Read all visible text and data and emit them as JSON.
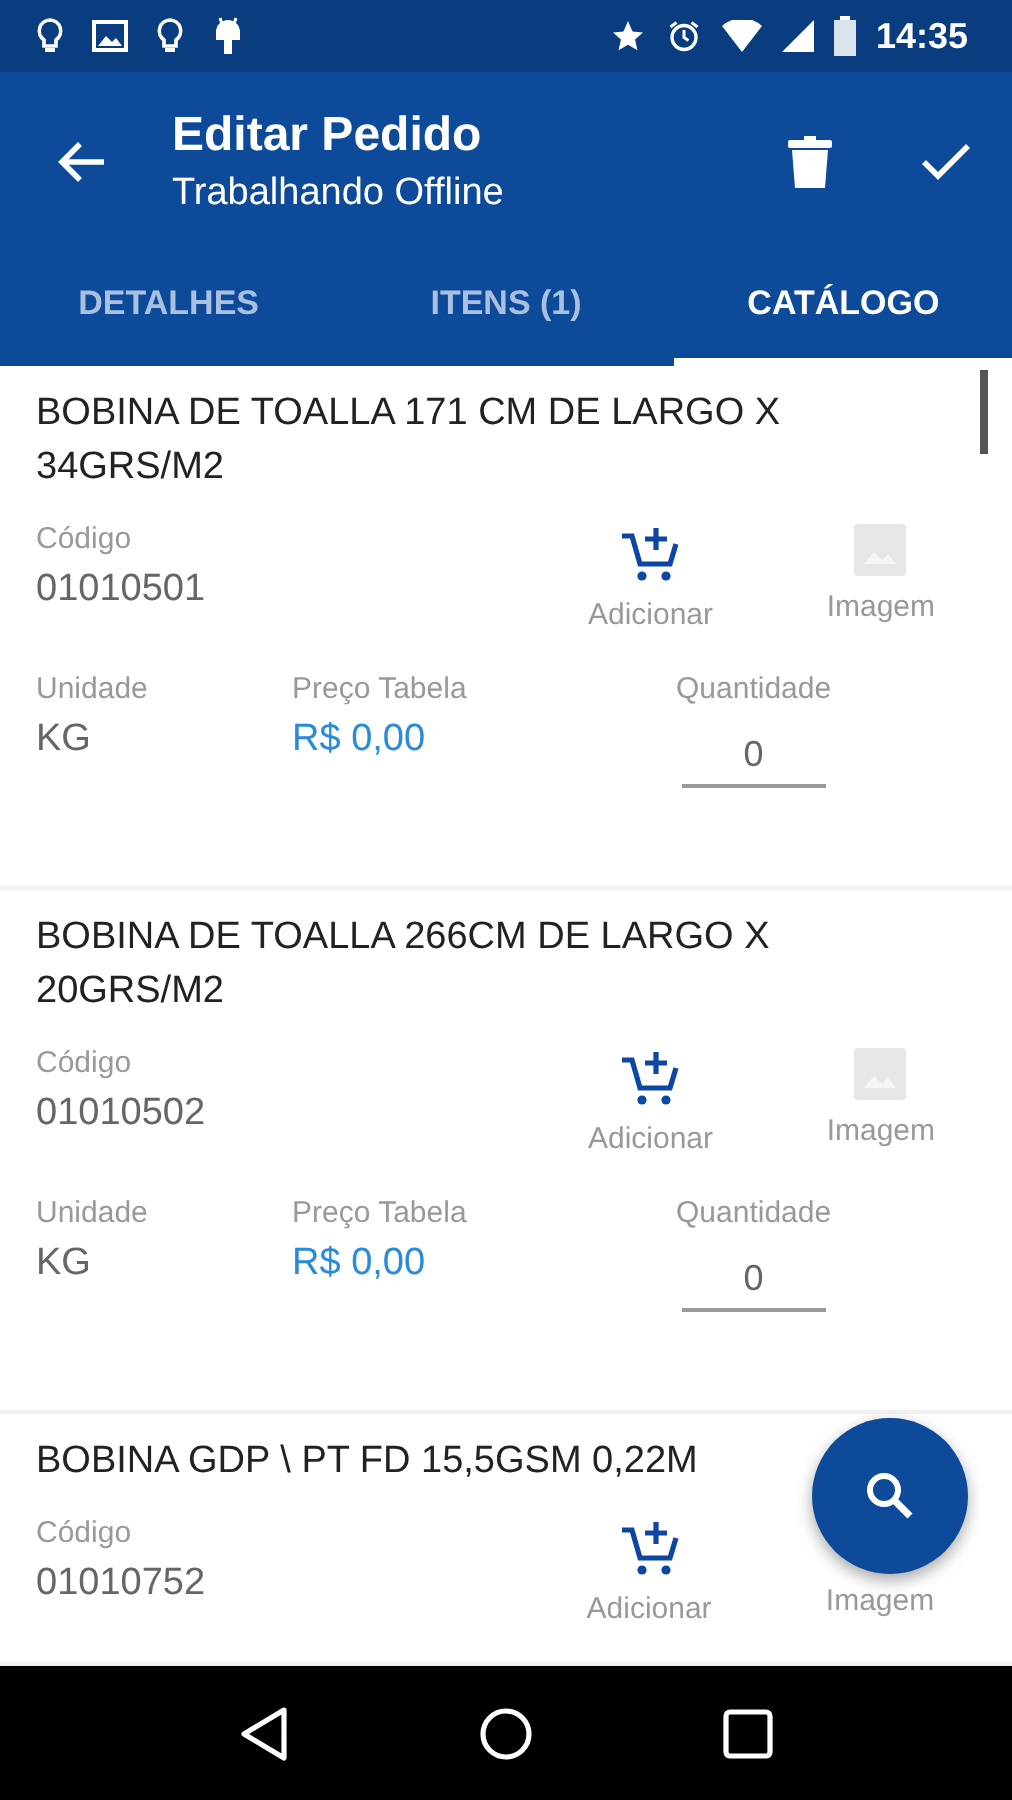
{
  "status_bar": {
    "time": "14:35"
  },
  "app_bar": {
    "title": "Editar Pedido",
    "subtitle": "Trabalhando Offline"
  },
  "tabs": [
    {
      "label": "DETALHES",
      "selected": false
    },
    {
      "label": "ITENS (1)",
      "selected": false
    },
    {
      "label": "CATÁLOGO",
      "selected": true
    }
  ],
  "products": [
    {
      "name": "BOBINA DE TOALLA 171 CM DE LARGO X 34GRS/M2",
      "code_label": "Código",
      "code": "01010501",
      "add_label": "Adicionar",
      "image_label": "Imagem",
      "unit_label": "Unidade",
      "unit": "KG",
      "price_label": "Preço Tabela",
      "price": "R$ 0,00",
      "quantity_label": "Quantidade",
      "quantity": "0"
    },
    {
      "name": "BOBINA DE TOALLA 266CM DE LARGO X 20GRS/M2",
      "code_label": "Código",
      "code": "01010502",
      "add_label": "Adicionar",
      "image_label": "Imagem",
      "unit_label": "Unidade",
      "unit": "KG",
      "price_label": "Preço Tabela",
      "price": "R$ 0,00",
      "quantity_label": "Quantidade",
      "quantity": "0"
    },
    {
      "name": "BOBINA GDP \\ PT FD 15,5GSM 0,22M",
      "code_label": "Código",
      "code": "01010752",
      "add_label": "Adicionar",
      "image_label": "Imagem"
    }
  ]
}
